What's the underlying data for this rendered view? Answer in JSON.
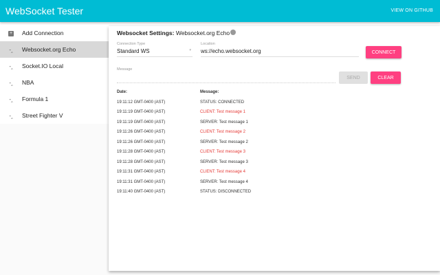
{
  "header": {
    "title": "WebSocket Tester",
    "github_link": "VIEW ON GITHUB"
  },
  "sidebar": {
    "add_label": "Add Connection",
    "items": [
      {
        "label": "Websocket.org Echo",
        "active": true
      },
      {
        "label": "Socket.IO Local"
      },
      {
        "label": "NBA"
      },
      {
        "label": "Formula 1"
      },
      {
        "label": "Street Fighter V"
      }
    ]
  },
  "settings": {
    "title_prefix": "Websocket Settings:",
    "title_name": "Websocket.org Echo",
    "connection_type_label": "Connection Type",
    "connection_type_value": "Standard WS",
    "location_label": "Location",
    "location_value": "ws://echo.websocket.org",
    "message_label": "Message",
    "message_value": "",
    "connect_label": "CONNECT",
    "send_label": "SEND",
    "clear_label": "CLEAR"
  },
  "log": {
    "headers": [
      "Date:",
      "Message:"
    ],
    "rows": [
      {
        "date": "19:11:12 GMT-0400 (AST)",
        "message": "STATUS: CONNECTED",
        "type": "status"
      },
      {
        "date": "19:11:19 GMT-0400 (AST)",
        "message": "CLIENT: Test message 1",
        "type": "client"
      },
      {
        "date": "19:11:19 GMT-0400 (AST)",
        "message": "SERVER: Test message 1",
        "type": "server"
      },
      {
        "date": "19:11:26 GMT-0400 (AST)",
        "message": "CLIENT: Test message 2",
        "type": "client"
      },
      {
        "date": "19:11:26 GMT-0400 (AST)",
        "message": "SERVER: Test message 2",
        "type": "server"
      },
      {
        "date": "19:11:28 GMT-0400 (AST)",
        "message": "CLIENT: Test message 3",
        "type": "client"
      },
      {
        "date": "19:11:28 GMT-0400 (AST)",
        "message": "SERVER: Test message 3",
        "type": "server"
      },
      {
        "date": "19:11:31 GMT-0400 (AST)",
        "message": "CLIENT: Test message 4",
        "type": "client"
      },
      {
        "date": "19:11:31 GMT-0400 (AST)",
        "message": "SERVER: Test message 4",
        "type": "server"
      },
      {
        "date": "19:11:40 GMT-0400 (AST)",
        "message": "STATUS: DISCONNECTED",
        "type": "status"
      }
    ]
  },
  "colors": {
    "primary": "#00bcd4",
    "accent": "#ff4081",
    "client": "#e53935"
  }
}
